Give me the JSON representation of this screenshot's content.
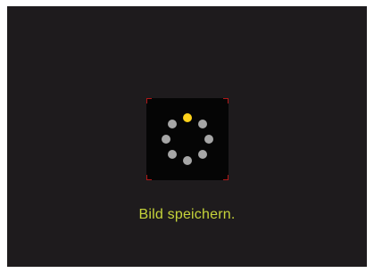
{
  "status": {
    "message": "Bild speichern."
  },
  "spinner": {
    "icon": "loading-spinner-icon",
    "dot_count": 8,
    "active_index": 0
  },
  "colors": {
    "screen_bg": "#1e1b1d",
    "box_bg": "#050505",
    "corner_marks": "#b01818",
    "text": "#c6d43a",
    "dot_active": "#ffd21a",
    "dot_inactive": "#a6a6a6"
  }
}
